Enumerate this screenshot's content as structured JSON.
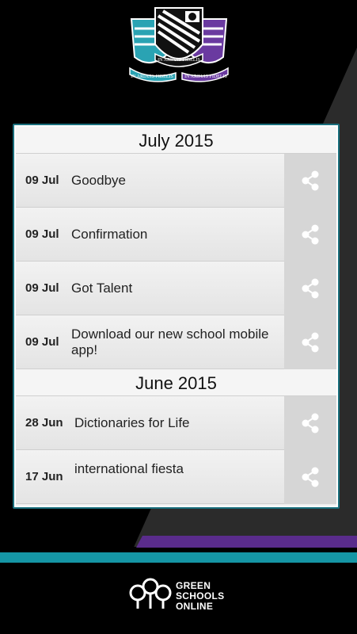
{
  "crest": {
    "motto_top": "IN ARDUIS FIDELIS",
    "motto_left": "IN ARDUIS FIDELIS",
    "motto_right": "IN ARDUIS FIDELIS"
  },
  "sections": [
    {
      "month": "July 2015",
      "items": [
        {
          "date": "09 Jul",
          "title": "Goodbye"
        },
        {
          "date": "09 Jul",
          "title": "Confirmation"
        },
        {
          "date": "09 Jul",
          "title": "Got Talent"
        },
        {
          "date": "09 Jul",
          "title": "Download our new school mobile app!"
        }
      ]
    },
    {
      "month": "June 2015",
      "items": [
        {
          "date": "28 Jun",
          "title": "Dictionaries for Life"
        },
        {
          "date": "17 Jun",
          "title": "international fiesta"
        }
      ]
    }
  ],
  "footer": {
    "brand_line1": "GREEN",
    "brand_line2": "SCHOOLS",
    "brand_line3": "ONLINE"
  },
  "colors": {
    "teal": "#1596a5",
    "purple": "#5a2c8c",
    "panel_border": "#1a6f7d"
  },
  "icons": {
    "share": "share-icon",
    "crest": "school-crest-logo",
    "brand": "green-schools-online-logo"
  }
}
